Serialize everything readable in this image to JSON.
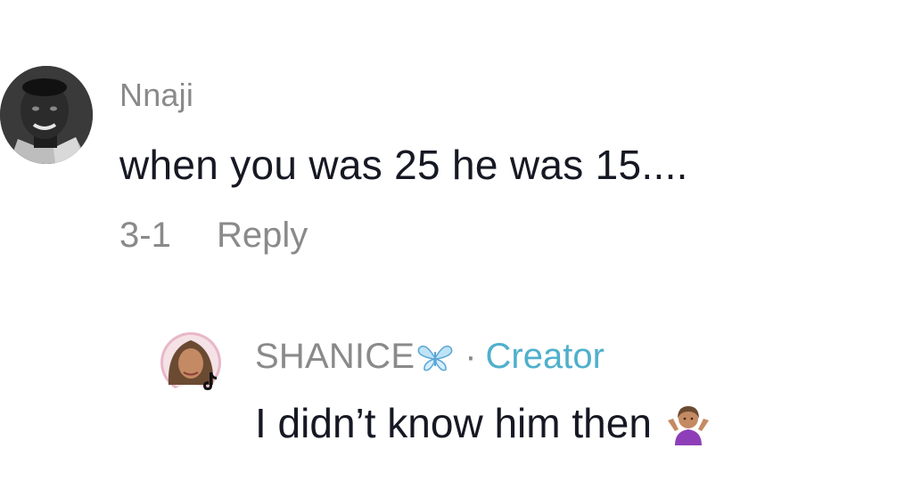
{
  "comment": {
    "username": "Nnaji",
    "text": "when you was 25 he was 15....",
    "date": "3-1",
    "reply_label": "Reply"
  },
  "reply": {
    "username": "SHANICE",
    "username_emoji": "butterfly-icon",
    "separator": "·",
    "badge": "Creator",
    "text": "I didn’t know him then",
    "text_emoji": "person-shrugging-icon"
  },
  "colors": {
    "muted": "#8a8a8a",
    "text": "#161823",
    "creator": "#4fb0cc"
  }
}
